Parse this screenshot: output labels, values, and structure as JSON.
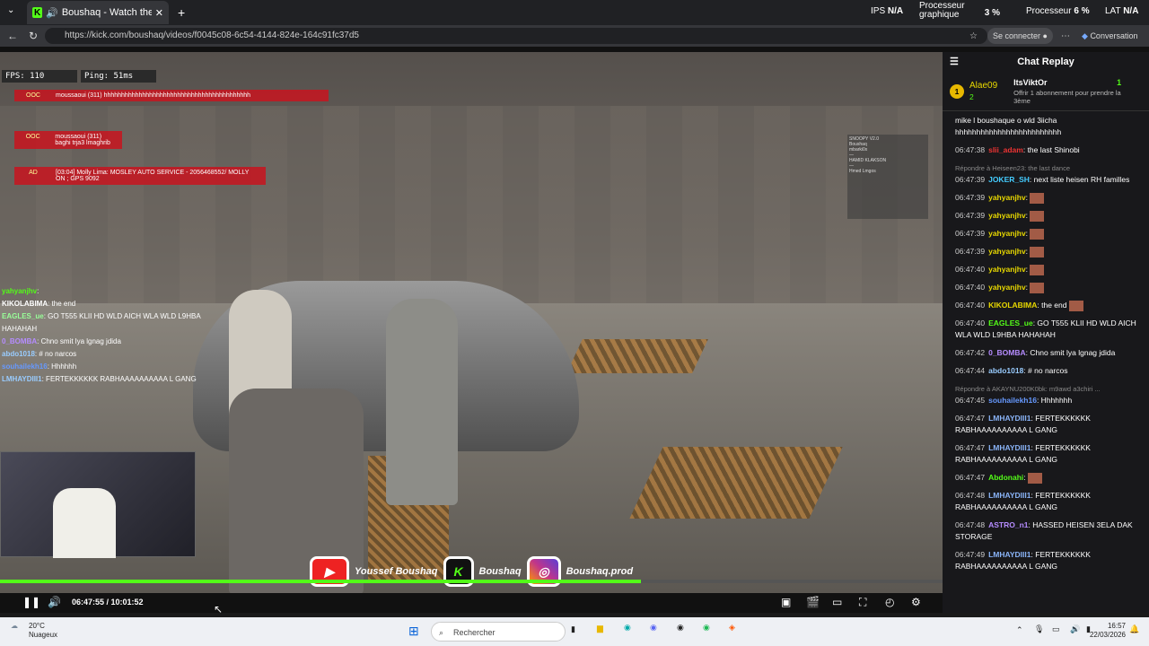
{
  "browser": {
    "tab_title": "Boushaq - Watch the VOD on",
    "url": "https://kick.com/boushaq/videos/f0045c08-6c54-4144-824e-164c91fc37d5",
    "signin": "Se connecter",
    "conversation": "Conversation",
    "perf": {
      "ips_label": "IPS",
      "ips_val": "N/A",
      "gpu_label": "Processeur graphique",
      "gpu_val": "3 %",
      "cpu_label": "Processeur",
      "cpu_val": "6 %",
      "lat_label": "LAT",
      "lat_val": "N/A"
    }
  },
  "video": {
    "fps": "FPS: 110",
    "ping": "Ping: 51ms",
    "rp": [
      {
        "tag": "OOC",
        "text": "moussaoui (311)  hhhhhhhhhhhhhhhhhhhhhhhhhhhhhhhhhhhhhhhhhh"
      },
      {
        "tag": "OOC",
        "text": "moussaoui (311)  baghi trja3 lmaghrib"
      },
      {
        "tag": "AD",
        "text": "[03:04] Molly Lima:  MOSLEY AUTO SERVICE - 2056468552/ MOLLY ON ; GPS 9092"
      }
    ],
    "overlay_chat": [
      {
        "user": "yahyanjhv",
        "text": ":",
        "color": "#53fc18"
      },
      {
        "user": "KIKOLABIMA",
        "text": ": the end",
        "color": "#fff"
      },
      {
        "user": "EAGLES_ue",
        "text": ": GO T555 KLII HD WLD AICH WLA WLD L9HBA HAHAHAH",
        "color": "#9f9"
      },
      {
        "user": "0_BOMBA",
        "text": ": Chno smit lya lgnag jdida",
        "color": "#b58cff"
      },
      {
        "user": "abdo1018",
        "text": ": # no narcos",
        "color": "#9cf"
      },
      {
        "user": "souhailekh16",
        "text": ": Hhhhhh",
        "color": "#69f"
      },
      {
        "user": "LMHAYDIII1",
        "text": ": FERTEKKKKKK RABHAAAAAAAAAA L GANG",
        "color": "#9cf"
      }
    ],
    "socials": [
      {
        "icon": "youtube-icon",
        "label": "Youssef Boushaq"
      },
      {
        "icon": "kick-icon",
        "label": "Boushaq"
      },
      {
        "icon": "instagram-icon",
        "label": "Boushaq.prod"
      }
    ],
    "time": "06:47:55 / 10:01:52",
    "progress": 0.68
  },
  "chat": {
    "title": "Chat Replay",
    "pinned_user": "Alae09",
    "pinned_rank": "1",
    "pinned_count": "2",
    "pinned_target": "ItsViktOr",
    "pinned_target_count": "1",
    "pinned_text": "Offrir 1 abonnement pour prendre la 3ème",
    "first_msg": "mike l boushaque o wld 3iicha hhhhhhhhhhhhhhhhhhhhhhhhh",
    "messages": [
      {
        "ts": "06:47:38",
        "user": "slii_adam",
        "color": "#e33",
        "text": ": the last Shinobi"
      },
      {
        "reply": "Répondre à Heiseen23: the last dance",
        "ts": "06:47:39",
        "user": "JOKER_SH",
        "color": "#4cf",
        "text": ": next liste heisen RH familles"
      },
      {
        "ts": "06:47:39",
        "user": "yahyanjhv",
        "color": "#e8d800",
        "text": ":",
        "emote": true
      },
      {
        "ts": "06:47:39",
        "user": "yahyanjhv",
        "color": "#e8d800",
        "text": ":",
        "emote": true
      },
      {
        "ts": "06:47:39",
        "user": "yahyanjhv",
        "color": "#e8d800",
        "text": ":",
        "emote": true
      },
      {
        "ts": "06:47:39",
        "user": "yahyanjhv",
        "color": "#e8d800",
        "text": ":",
        "emote": true
      },
      {
        "ts": "06:47:40",
        "user": "yahyanjhv",
        "color": "#e8d800",
        "text": ":",
        "emote": true
      },
      {
        "ts": "06:47:40",
        "user": "yahyanjhv",
        "color": "#e8d800",
        "text": ":",
        "emote": true
      },
      {
        "ts": "06:47:40",
        "user": "KIKOLABIMA",
        "color": "#e8d800",
        "text": ": the end",
        "emote": true
      },
      {
        "ts": "06:47:40",
        "user": "EAGLES_ue",
        "color": "#53fc18",
        "text": ": GO T555 KLII HD WLD AICH WLA WLD L9HBA HAHAHAH"
      },
      {
        "ts": "06:47:42",
        "user": "0_BOMBA",
        "color": "#b58cff",
        "text": ": Chno smit lya lgnag jdida"
      },
      {
        "ts": "06:47:44",
        "user": "abdo1018",
        "color": "#9cf",
        "text": ": # no narcos"
      },
      {
        "reply": "Répondre à AKAYNU200K0bk: m9awd a3chiri ...",
        "ts": "06:47:45",
        "user": "souhailekh16",
        "color": "#69f",
        "text": ": Hhhhhhh"
      },
      {
        "ts": "06:47:47",
        "user": "LMHAYDIII1",
        "color": "#8ab4f8",
        "text": ": FERTEKKKKKK RABHAAAAAAAAAA L GANG"
      },
      {
        "ts": "06:47:47",
        "user": "LMHAYDIII1",
        "color": "#8ab4f8",
        "text": ": FERTEKKKKKK RABHAAAAAAAAAA L GANG"
      },
      {
        "ts": "06:47:47",
        "user": "Abdonahi",
        "color": "#53fc18",
        "text": ":",
        "emote": true
      },
      {
        "ts": "06:47:48",
        "user": "LMHAYDIII1",
        "color": "#8ab4f8",
        "text": ": FERTEKKKKKK RABHAAAAAAAAAA L GANG"
      },
      {
        "ts": "06:47:48",
        "user": "ASTRO_n1",
        "color": "#b58cff",
        "text": ": HASSED HEISEN 3ELA DAK STORAGE"
      },
      {
        "ts": "06:47:49",
        "user": "LMHAYDIII1",
        "color": "#8ab4f8",
        "text": ": FERTEKKKKKK RABHAAAAAAAAAA L GANG"
      }
    ]
  },
  "taskbar": {
    "temp": "20°C",
    "weather": "Nuageux",
    "search": "Rechercher",
    "time": "16:57",
    "date": "22/03/2026"
  }
}
